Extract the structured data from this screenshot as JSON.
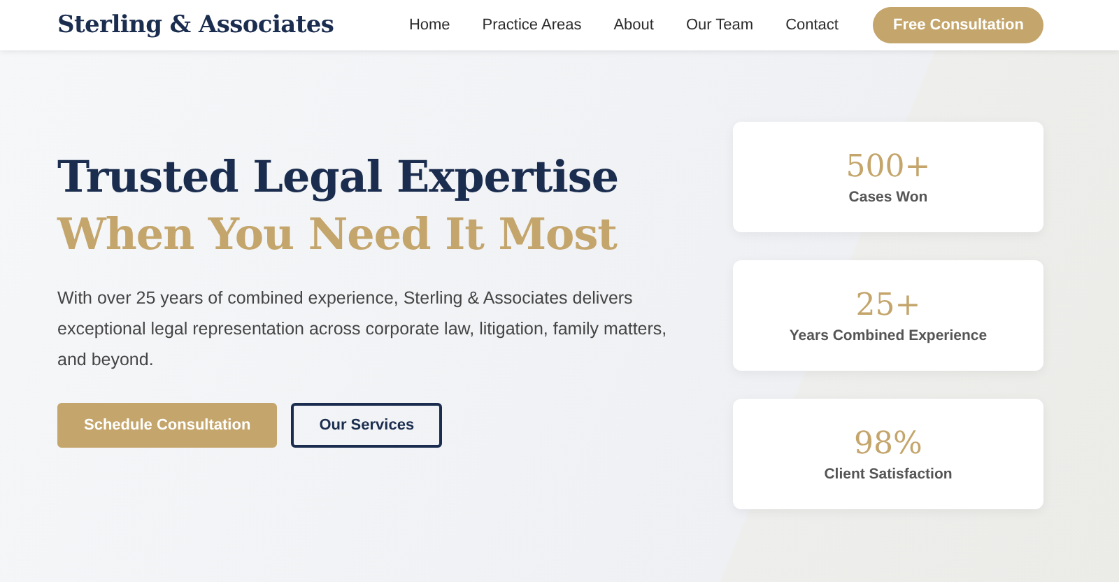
{
  "header": {
    "logo": "Sterling & Associates",
    "nav": [
      "Home",
      "Practice Areas",
      "About",
      "Our Team",
      "Contact"
    ],
    "cta": "Free Consultation"
  },
  "hero": {
    "heading_lines": [
      {
        "text": "Trusted Legal Expertise",
        "kind": "primary"
      },
      {
        "text": "When You Need It Most",
        "kind": "accent"
      }
    ],
    "description": "With over 25 years of combined experience, Sterling & Associates delivers exceptional legal representation across corporate law, litigation, family matters, and beyond.",
    "buttons": [
      {
        "label": "Schedule Consultation",
        "kind": "filled"
      },
      {
        "label": "Our Services",
        "kind": "outline"
      }
    ]
  },
  "stats": [
    {
      "value": "500+",
      "label": "Cases Won"
    },
    {
      "value": "25+",
      "label": "Years Combined Experience"
    },
    {
      "value": "98%",
      "label": "Client Satisfaction"
    }
  ]
}
